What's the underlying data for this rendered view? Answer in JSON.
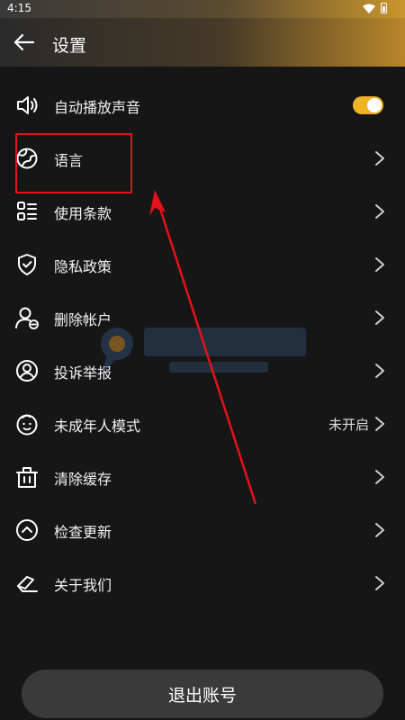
{
  "status_bar": {
    "time": "4:15"
  },
  "header": {
    "title": "设置"
  },
  "settings": [
    {
      "label": "自动播放声音",
      "icon": "speaker-icon",
      "control": "toggle",
      "toggle_on": true
    },
    {
      "label": "语言",
      "icon": "globe-icon",
      "control": "chevron"
    },
    {
      "label": "使用条款",
      "icon": "list-icon",
      "control": "chevron"
    },
    {
      "label": "隐私政策",
      "icon": "shield-icon",
      "control": "chevron"
    },
    {
      "label": "删除帐户",
      "icon": "user-remove-icon",
      "control": "chevron"
    },
    {
      "label": "投诉举报",
      "icon": "report-icon",
      "control": "chevron"
    },
    {
      "label": "未成年人模式",
      "icon": "child-face-icon",
      "control": "chevron",
      "status": "未开启"
    },
    {
      "label": "清除缓存",
      "icon": "trash-icon",
      "control": "chevron"
    },
    {
      "label": "检查更新",
      "icon": "update-icon",
      "control": "chevron"
    },
    {
      "label": "关于我们",
      "icon": "about-icon",
      "control": "chevron"
    }
  ],
  "logout_label": "退出账号",
  "colors": {
    "accent": "#f0b323",
    "annotation": "#e3121b",
    "background": "#161616"
  }
}
